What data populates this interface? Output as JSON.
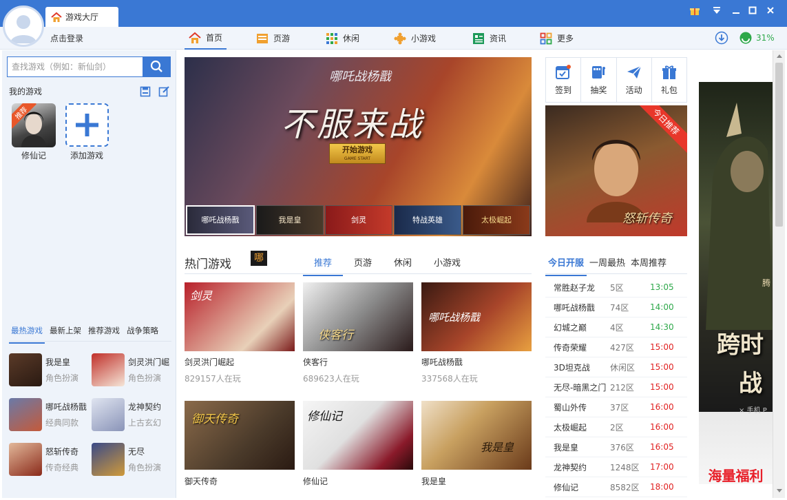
{
  "window": {
    "tab_title": "游戏大厅",
    "login_label": "点击登录"
  },
  "nav": [
    {
      "label": "首页",
      "icon": "home-icon"
    },
    {
      "label": "页游",
      "icon": "web-game-icon"
    },
    {
      "label": "休闲",
      "icon": "casual-grid-icon"
    },
    {
      "label": "小游戏",
      "icon": "puzzle-icon"
    },
    {
      "label": "资讯",
      "icon": "news-icon"
    },
    {
      "label": "更多",
      "icon": "more-grid-icon"
    }
  ],
  "status": {
    "percent": "31%"
  },
  "left": {
    "search_placeholder": "查找游戏（例如：新仙剑）",
    "my_games_label": "我的游戏",
    "my_games": [
      {
        "name": "修仙记",
        "badge": "推荐"
      }
    ],
    "add_game_label": "添加游戏",
    "tabs": [
      "最热游戏",
      "最新上架",
      "推荐游戏",
      "战争策略"
    ],
    "hot_games": [
      {
        "name": "我是皇",
        "genre": "角色扮演"
      },
      {
        "name": "剑灵洪门崛",
        "genre": "角色扮演"
      },
      {
        "name": "哪吒战杨戬",
        "genre": "经典同款"
      },
      {
        "name": "龙神契约",
        "genre": "上古玄幻"
      },
      {
        "name": "怒斩传奇",
        "genre": "传奇经典"
      },
      {
        "name": "无尽",
        "genre": "角色扮演"
      }
    ]
  },
  "banner": {
    "title": "不服来战",
    "start_label": "开始游戏",
    "start_sub": "GAME START",
    "logo": "哪吒战杨戬"
  },
  "thumbs": [
    "哪吒战杨戬",
    "我是皇",
    "剑灵",
    "特战英雄",
    "太极崛起"
  ],
  "quick": [
    {
      "label": "签到",
      "icon": "calendar-check-icon"
    },
    {
      "label": "抽奖",
      "icon": "lottery-icon"
    },
    {
      "label": "活动",
      "icon": "paper-plane-icon"
    },
    {
      "label": "礼包",
      "icon": "gift-icon"
    }
  ],
  "promo": {
    "ribbon": "今日推荐",
    "logo": "怒斩传奇"
  },
  "hot": {
    "title": "热门游戏",
    "badge": "哪",
    "tabs": [
      "推荐",
      "页游",
      "休闲",
      "小游戏"
    ],
    "cards": [
      {
        "name": "剑灵洪门崛起",
        "players": "829157人在玩",
        "logo": "剑灵"
      },
      {
        "name": "侠客行",
        "players": "689623人在玩",
        "logo": "侠客行"
      },
      {
        "name": "哪吒战杨戬",
        "players": "337568人在玩",
        "logo": "哪吒战杨戬"
      },
      {
        "name": "御天传奇",
        "players": "",
        "logo": "御天传奇"
      },
      {
        "name": "修仙记",
        "players": "",
        "logo": "修仙记"
      },
      {
        "name": "我是皇",
        "players": "",
        "logo": "我是皇"
      }
    ]
  },
  "servers": {
    "tabs": [
      "今日开服",
      "一周最热",
      "本周推荐"
    ],
    "rows": [
      {
        "name": "常胜赵子龙",
        "zone": "5区",
        "time": "13:05",
        "state": "past"
      },
      {
        "name": "哪吒战杨戬",
        "zone": "74区",
        "time": "14:00",
        "state": "past"
      },
      {
        "name": "幻城之巅",
        "zone": "4区",
        "time": "14:30",
        "state": "past"
      },
      {
        "name": "传奇荣耀",
        "zone": "427区",
        "time": "15:00",
        "state": "future"
      },
      {
        "name": "3D坦克战",
        "zone": "休闲区",
        "time": "15:00",
        "state": "future"
      },
      {
        "name": "无尽-暗黑之门",
        "zone": "212区",
        "time": "15:00",
        "state": "future"
      },
      {
        "name": "蜀山外传",
        "zone": "37区",
        "time": "16:00",
        "state": "future"
      },
      {
        "name": "太极崛起",
        "zone": "2区",
        "time": "16:00",
        "state": "future"
      },
      {
        "name": "我是皇",
        "zone": "376区",
        "time": "16:05",
        "state": "future"
      },
      {
        "name": "龙神契约",
        "zone": "1248区",
        "time": "17:00",
        "state": "future"
      },
      {
        "name": "修仙记",
        "zone": "8582区",
        "time": "18:00",
        "state": "future"
      }
    ]
  },
  "ad": {
    "line1": "跨时",
    "line2": "战",
    "small": "腾",
    "sub": "× 手机 P",
    "footer": "海量福利"
  },
  "colors": {
    "accent": "#3a78d4",
    "past_time": "#2ea84a",
    "future_time": "#e02020"
  }
}
